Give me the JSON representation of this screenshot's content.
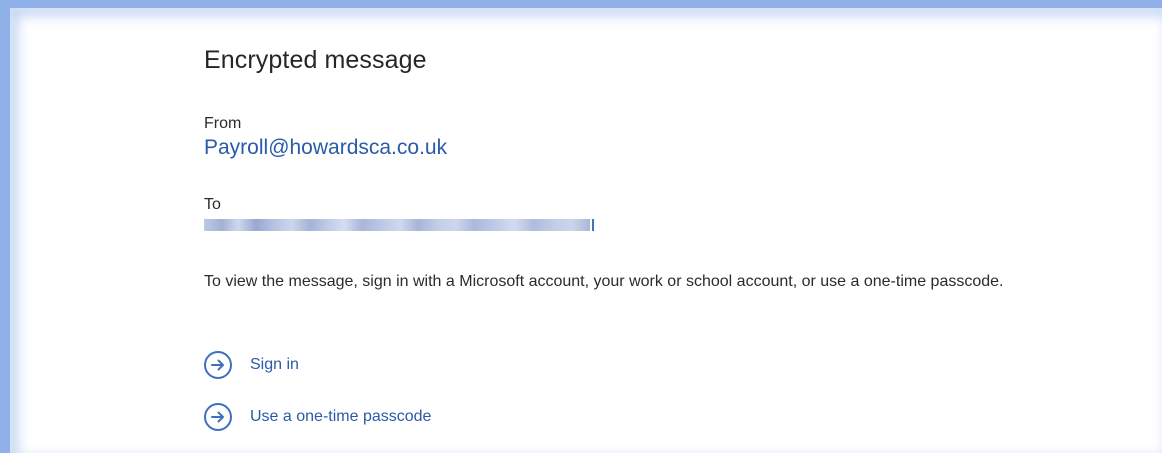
{
  "message": {
    "title": "Encrypted message",
    "from_label": "From",
    "from_value": "Payroll@howardsca.co.uk",
    "to_label": "To",
    "to_value_redacted": true,
    "instructions": "To view the message, sign in with a Microsoft account, your work or school account, or use a one-time passcode."
  },
  "actions": [
    {
      "label": "Sign in",
      "icon": "circle-arrow-right-icon"
    },
    {
      "label": "Use a one-time passcode",
      "icon": "circle-arrow-right-icon"
    }
  ],
  "colors": {
    "link": "#2b5aa8",
    "frame_glow": "#8fb0e8",
    "text": "#2b2b2b"
  }
}
